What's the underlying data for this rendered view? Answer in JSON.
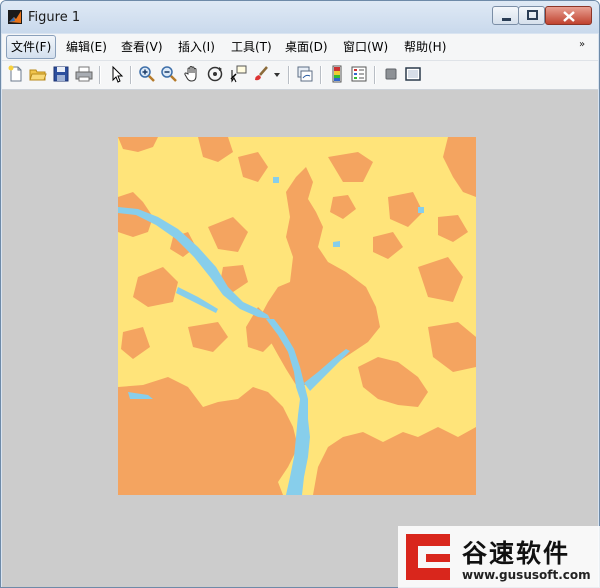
{
  "window": {
    "title": "Figure 1"
  },
  "menu": {
    "items": [
      {
        "label": "文件(F)"
      },
      {
        "label": "编辑(E)"
      },
      {
        "label": "查看(V)"
      },
      {
        "label": "插入(I)"
      },
      {
        "label": "工具(T)"
      },
      {
        "label": "桌面(D)"
      },
      {
        "label": "窗口(W)"
      },
      {
        "label": "帮助(H)"
      }
    ],
    "overflow": "»"
  },
  "toolbar": {
    "icons": [
      "new-figure-icon",
      "open-file-icon",
      "save-icon",
      "print-icon",
      "pointer-icon",
      "zoom-in-icon",
      "zoom-out-icon",
      "pan-hand-icon",
      "rotate-3d-icon",
      "data-cursor-icon",
      "brush-icon",
      "link-plot-icon",
      "colorbar-icon",
      "legend-icon",
      "hide-plot-tools-icon",
      "show-plot-tools-icon"
    ]
  },
  "figure": {
    "type": "classified-land-cover-image",
    "colors": {
      "background": "#cccccc",
      "land": "#ffe47a",
      "urban": "#f4a460",
      "water": "#87ceeb"
    }
  },
  "watermark": {
    "name": "谷速软件",
    "url": "www.gususoft.com"
  }
}
